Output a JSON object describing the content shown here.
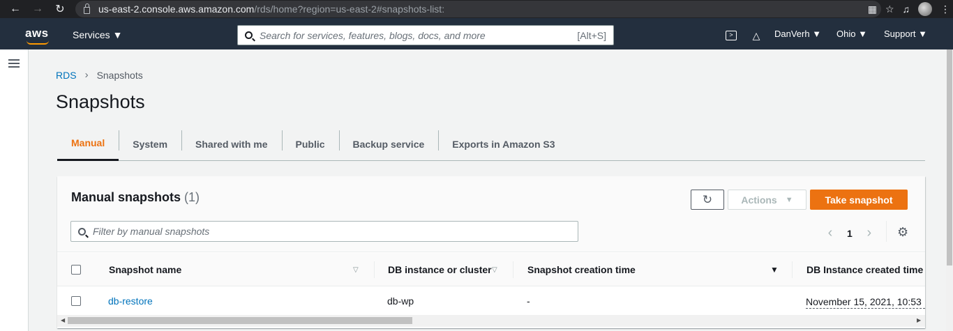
{
  "browser": {
    "url_host": "us-east-2.console.aws.amazon.com",
    "url_path": "/rds/home?region=us-east-2#snapshots-list:"
  },
  "aws_nav": {
    "logo": "aws",
    "services_label": "Services ▼",
    "search_placeholder": "Search for services, features, blogs, docs, and more",
    "search_shortcut": "[Alt+S]",
    "user_label": "DanVerh ▼",
    "region_label": "Ohio ▼",
    "support_label": "Support ▼"
  },
  "breadcrumb": {
    "root": "RDS",
    "separator": "›",
    "current": "Snapshots"
  },
  "page_title": "Snapshots",
  "tabs": [
    {
      "label": "Manual",
      "active": true
    },
    {
      "label": "System"
    },
    {
      "label": "Shared with me"
    },
    {
      "label": "Public"
    },
    {
      "label": "Backup service"
    },
    {
      "label": "Exports in Amazon S3"
    }
  ],
  "panel": {
    "title": "Manual snapshots",
    "count": "(1)",
    "actions_label": "Actions",
    "take_snapshot_label": "Take snapshot",
    "filter_placeholder": "Filter by manual snapshots",
    "page_number": "1"
  },
  "table": {
    "columns": [
      "Snapshot name",
      "DB instance or cluster",
      "Snapshot creation time",
      "DB Instance created time"
    ],
    "rows": [
      {
        "snapshot_name": "db-restore",
        "db_instance": "db-wp",
        "creation_time": "-",
        "instance_created": "November 15, 2021, 10:53"
      }
    ]
  },
  "colors": {
    "accent": "#ec7211",
    "link": "#0073bb",
    "nav_bg": "#232f3e"
  }
}
